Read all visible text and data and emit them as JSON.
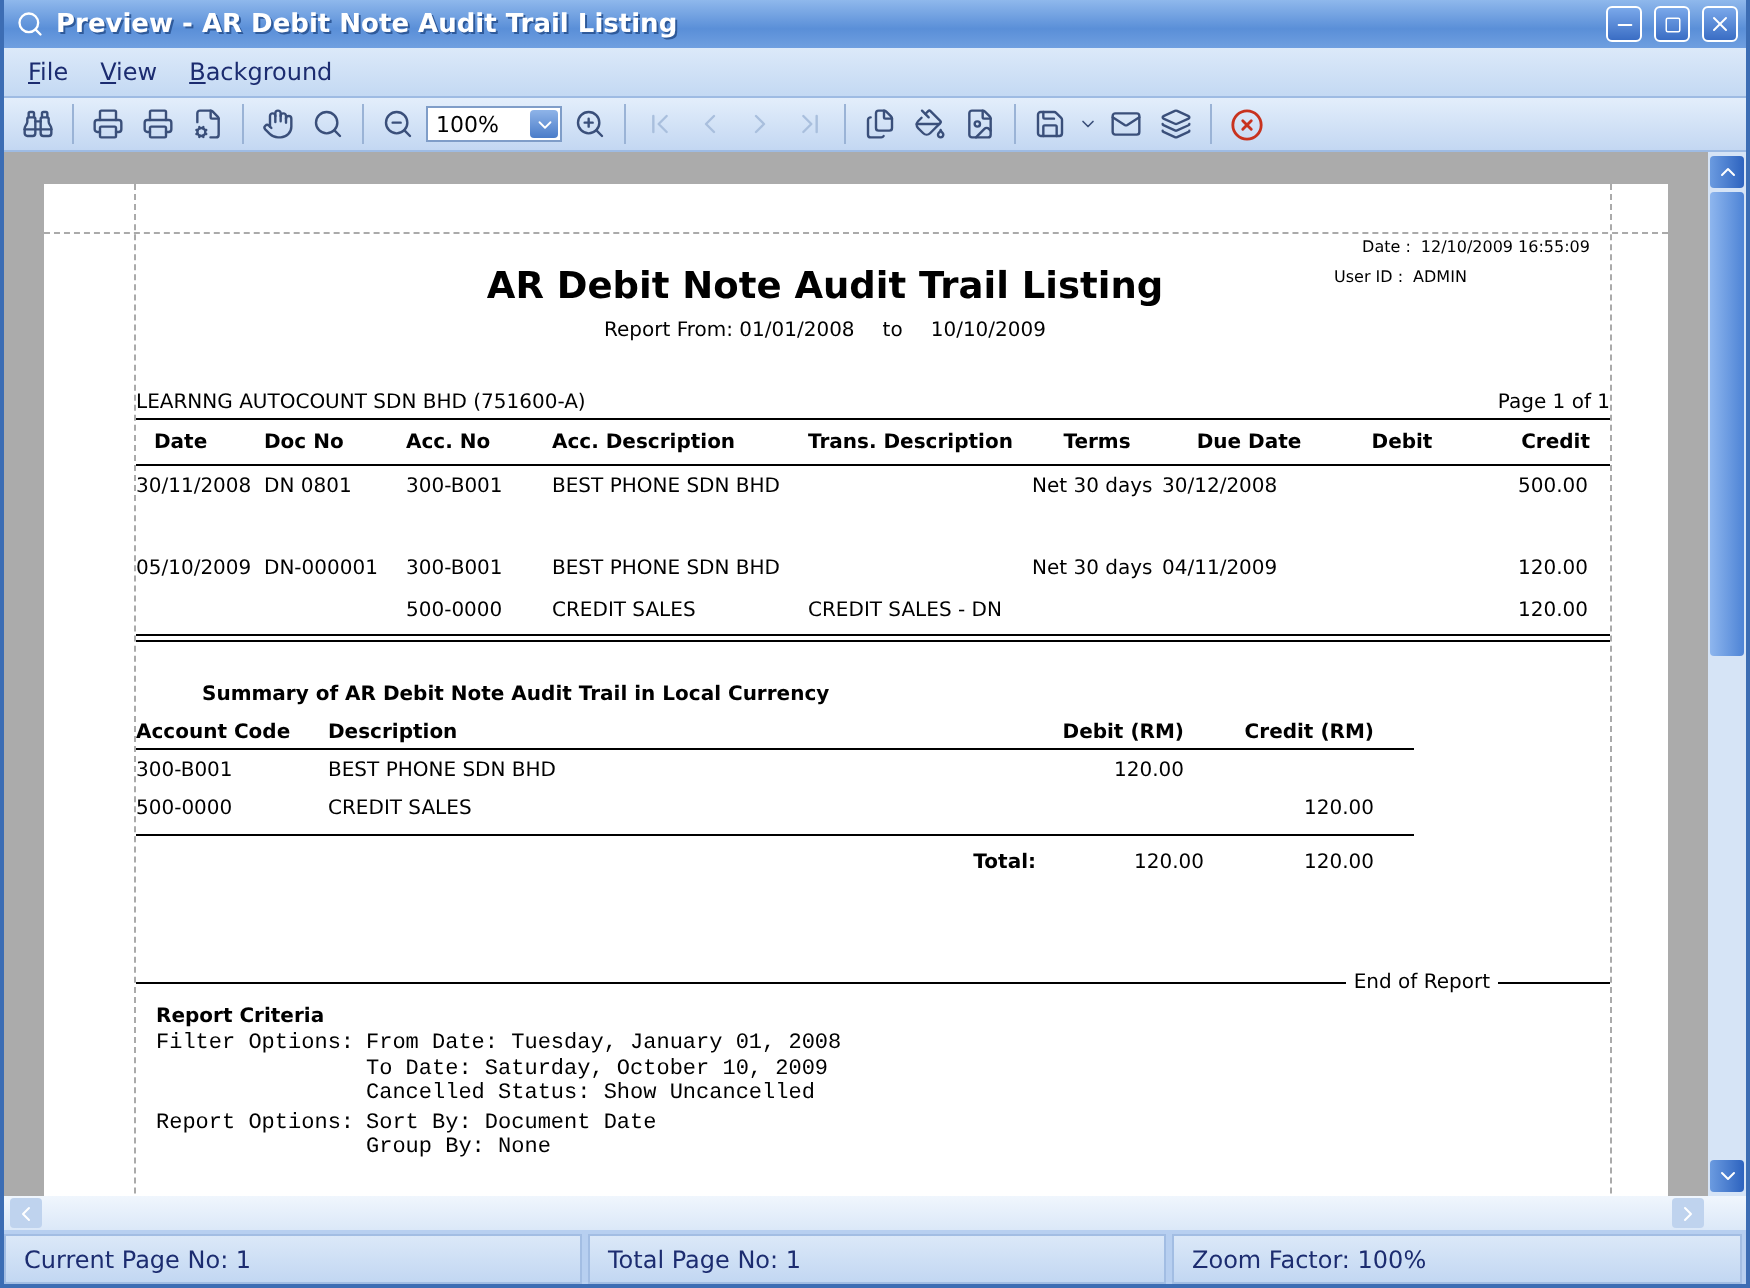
{
  "window": {
    "title": "Preview - AR Debit Note Audit Trail Listing"
  },
  "menu": [
    {
      "label": "File"
    },
    {
      "label": "View"
    },
    {
      "label": "Background"
    }
  ],
  "toolbar": {
    "zoom": "100%",
    "nav_buttons": [
      {
        "disabled": true
      },
      {
        "disabled": true
      },
      {
        "disabled": true
      },
      {
        "disabled": true
      }
    ]
  },
  "report": {
    "date_label": "Date :",
    "date": "12/10/2009 16:55:09",
    "user_label": "User ID :",
    "user": "ADMIN",
    "title": "AR Debit Note Audit Trail Listing",
    "range_from": "Report From: 01/01/2008",
    "range_to_word": "to",
    "range_to": "10/10/2009",
    "company": "LEARNNG AUTOCOUNT SDN BHD (751600-A)",
    "page": "Page 1 of 1",
    "columns": [
      "Date",
      "Doc No",
      "Acc. No",
      "Acc. Description",
      "Trans. Description",
      "Terms",
      "Due Date",
      "Debit",
      "Credit"
    ],
    "documents": [
      {
        "lines": [
          {
            "date": "30/11/2008",
            "doc_no": "DN 0801",
            "acc_no": "300-B001",
            "acc_description": "BEST PHONE SDN BHD",
            "terms": "Net 30 days",
            "due_date": "30/12/2008",
            "credit": "500.00"
          }
        ]
      },
      {
        "lines": [
          {
            "date": "05/10/2009",
            "doc_no": "DN-000001",
            "acc_no": "300-B001",
            "acc_description": "BEST PHONE SDN BHD",
            "terms": "Net 30 days",
            "due_date": "04/11/2009",
            "credit": "120.00"
          },
          {
            "acc_no": "500-0000",
            "acc_description": "CREDIT SALES",
            "trans_description": "CREDIT SALES - DN",
            "credit": "120.00"
          }
        ]
      }
    ],
    "summary": {
      "title": "Summary of AR Debit Note Audit Trail in Local Currency",
      "columns": [
        "Account Code",
        "Description",
        "Debit (RM)",
        "Credit (RM)"
      ],
      "rows": [
        {
          "account_code": "300-B001",
          "description": "BEST PHONE SDN BHD",
          "debit": "120.00"
        },
        {
          "account_code": "500-0000",
          "description": "CREDIT SALES",
          "credit": "120.00"
        }
      ],
      "total_label": "Total:",
      "total_debit": "120.00",
      "total_credit": "120.00"
    },
    "end_text": "End of Report",
    "criteria": {
      "title": "Report Criteria",
      "groups": [
        {
          "label": "Filter Options:",
          "values": [
            "From Date: Tuesday, January 01, 2008",
            "To Date: Saturday, October 10, 2009",
            "Cancelled Status: Show Uncancelled"
          ]
        },
        {
          "label": "Report Options:",
          "values": [
            "Sort By: Document Date",
            "Group By: None"
          ]
        }
      ]
    }
  },
  "status_bar": [
    "Current Page No: 1",
    "Total Page No: 1",
    "Zoom Factor: 100%"
  ]
}
